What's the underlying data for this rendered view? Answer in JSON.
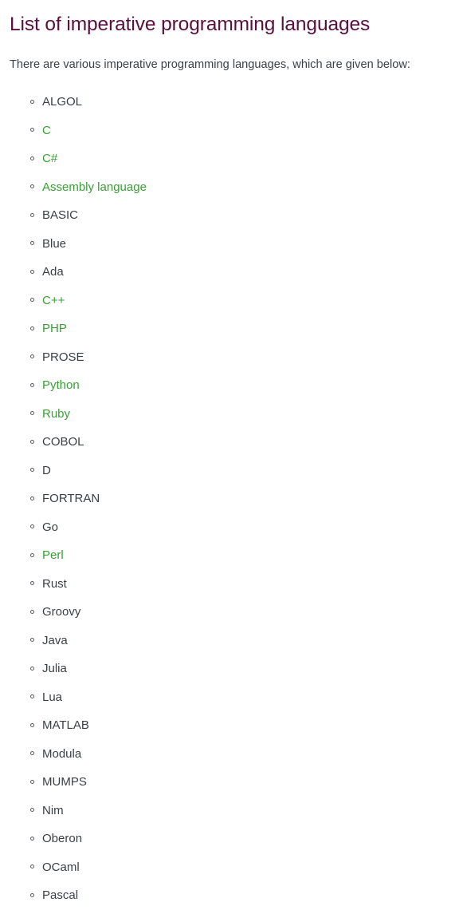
{
  "page": {
    "title": "List of imperative programming languages",
    "intro": "There are various imperative programming languages, which are given below:",
    "title_color": "#5a0f3c",
    "body_text_color": "#3b4045",
    "link_color": "#38a035",
    "background_color": "#ffffff",
    "bullet_icon": "hollow-circle-bullet"
  },
  "list": {
    "marker_style": "circle",
    "items": [
      {
        "label": "ALGOL",
        "is_link": false
      },
      {
        "label": "C",
        "is_link": true
      },
      {
        "label": "C#",
        "is_link": true
      },
      {
        "label": "Assembly language",
        "is_link": true
      },
      {
        "label": "BASIC",
        "is_link": false
      },
      {
        "label": "Blue",
        "is_link": false
      },
      {
        "label": "Ada",
        "is_link": false
      },
      {
        "label": "C++",
        "is_link": true
      },
      {
        "label": "PHP",
        "is_link": true
      },
      {
        "label": "PROSE",
        "is_link": false
      },
      {
        "label": "Python",
        "is_link": true
      },
      {
        "label": "Ruby",
        "is_link": true
      },
      {
        "label": "COBOL",
        "is_link": false
      },
      {
        "label": "D",
        "is_link": false
      },
      {
        "label": "FORTRAN",
        "is_link": false
      },
      {
        "label": "Go",
        "is_link": false
      },
      {
        "label": "Perl",
        "is_link": true
      },
      {
        "label": "Rust",
        "is_link": false
      },
      {
        "label": "Groovy",
        "is_link": false
      },
      {
        "label": "Java",
        "is_link": false
      },
      {
        "label": "Julia",
        "is_link": false
      },
      {
        "label": "Lua",
        "is_link": false
      },
      {
        "label": "MATLAB",
        "is_link": false
      },
      {
        "label": "Modula",
        "is_link": false
      },
      {
        "label": "MUMPS",
        "is_link": false
      },
      {
        "label": "Nim",
        "is_link": false
      },
      {
        "label": "Oberon",
        "is_link": false
      },
      {
        "label": "OCaml",
        "is_link": false
      },
      {
        "label": "Pascal",
        "is_link": false
      }
    ]
  }
}
